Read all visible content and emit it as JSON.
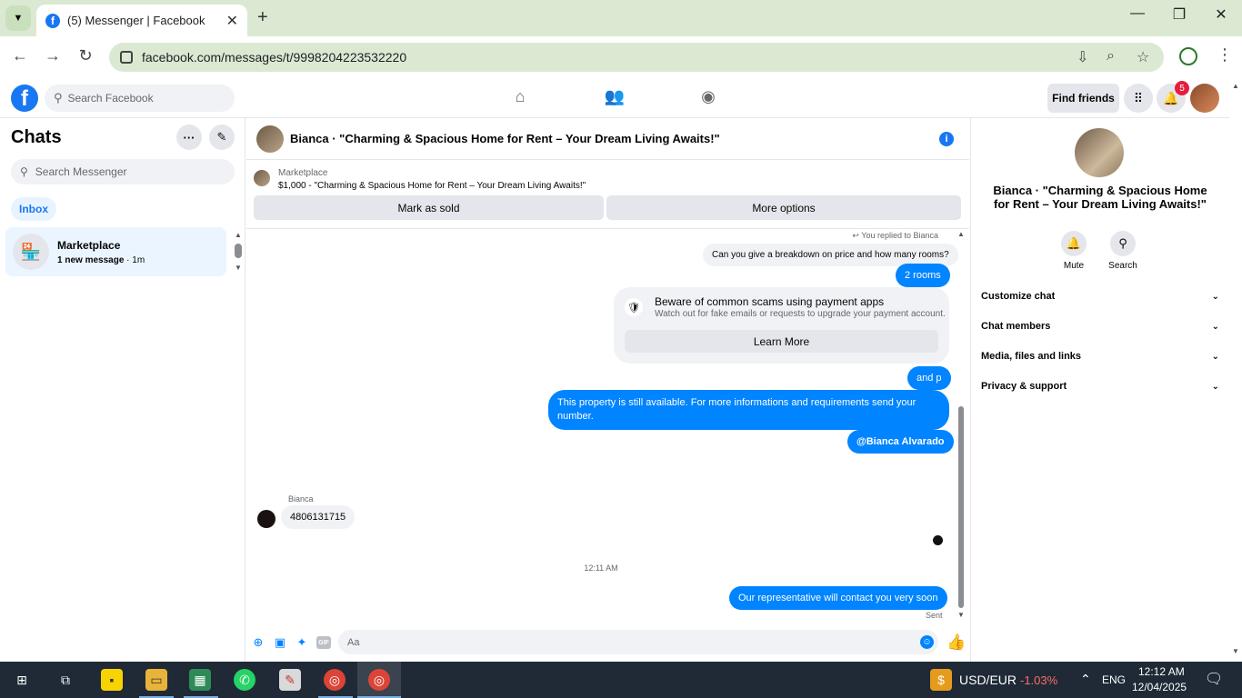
{
  "browser": {
    "tab_title": "(5) Messenger | Facebook",
    "url": "facebook.com/messages/t/9998204223532220"
  },
  "fb_header": {
    "search_placeholder": "Search Facebook",
    "find_friends": "Find friends",
    "notification_count": "5"
  },
  "left": {
    "title": "Chats",
    "search_placeholder": "Search Messenger",
    "filter": "Inbox",
    "chats": [
      {
        "name": "Marketplace",
        "preview": "1 new message",
        "time": "· 1m"
      }
    ]
  },
  "conversation": {
    "title": "Bianca · \"Charming & Spacious Home for Rent – Your Dream Living Awaits!\"",
    "marketplace_label": "Marketplace",
    "listing": "$1,000 - \"Charming & Spacious Home for Rent – Your Dream Living Awaits!\"",
    "mark_sold": "Mark as sold",
    "more_options": "More options",
    "replied_note": "You replied to Bianca",
    "messages": {
      "quoted": "Can you give a breakdown on price and how many rooms?",
      "m1": "2 rooms",
      "m2": "and p",
      "m3": "This property is still available. For more informations and requirements send your number.",
      "m4": "@Bianca Alvarado",
      "incoming_sender": "Bianca",
      "incoming": "4806131715",
      "time_divider": "12:11 AM",
      "m5": "Our representative will contact you very soon",
      "status": "Sent"
    },
    "scam": {
      "title": "Beware of common scams using payment apps",
      "desc": "Watch out for fake emails or requests to upgrade your payment account.",
      "button": "Learn More"
    },
    "composer_placeholder": "Aa",
    "gif": "GIF"
  },
  "right": {
    "name": "Bianca · \"Charming & Spacious Home for Rent – Your Dream Living Awaits!\"",
    "actions": [
      "Mute",
      "Search"
    ],
    "sections": [
      "Customize chat",
      "Chat members",
      "Media, files and links",
      "Privacy & support"
    ]
  },
  "taskbar": {
    "currency": "USD/EUR",
    "change": "-1.03%",
    "lang": "ENG",
    "time": "12:12 AM",
    "date": "12/04/2025"
  },
  "colors": {
    "brand": "#1877f2",
    "outgoing_bubble": "#0084ff",
    "negative": "#ff6b6b"
  }
}
